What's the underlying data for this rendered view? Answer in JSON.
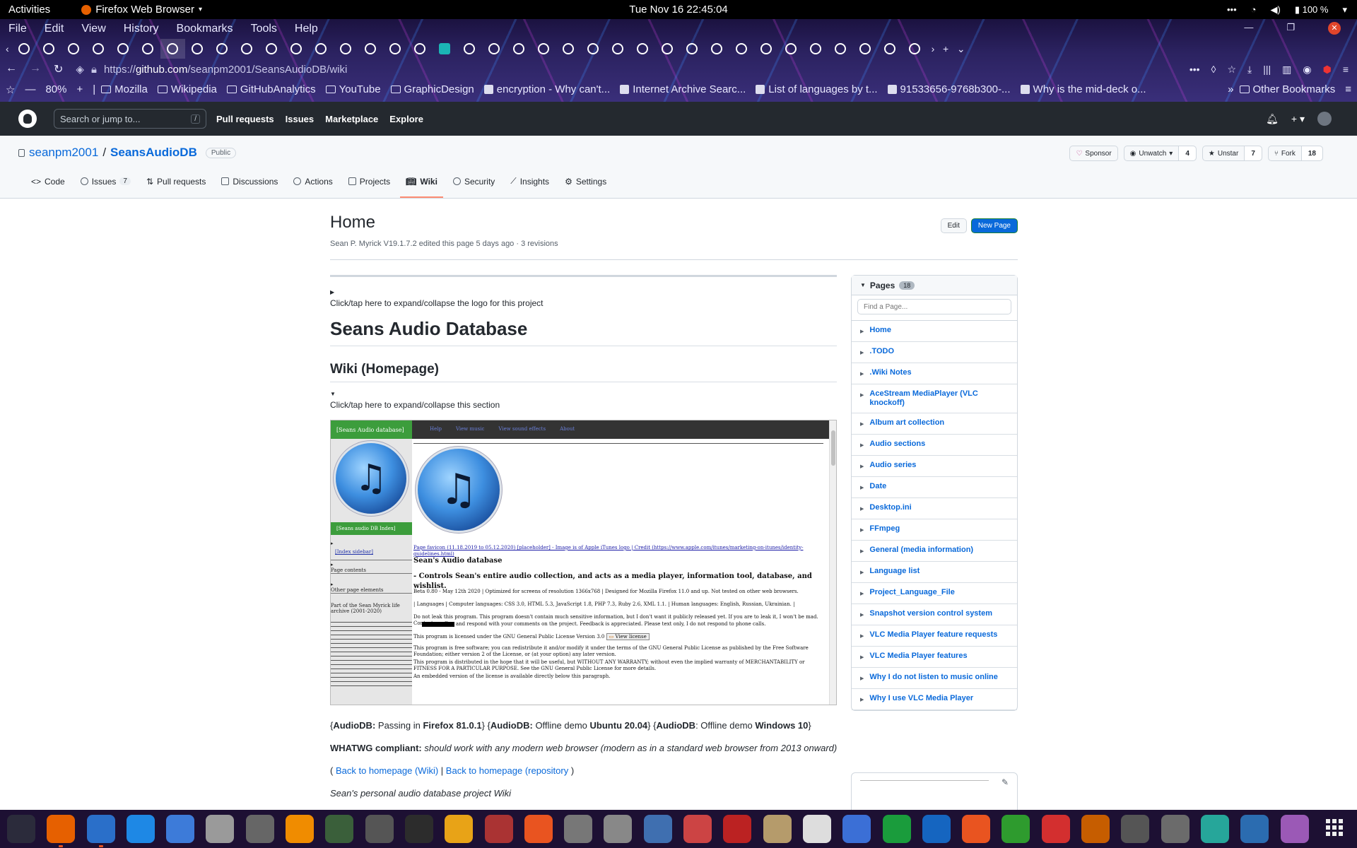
{
  "gnome": {
    "activities": "Activities",
    "app_name": "Firefox Web Browser",
    "clock": "Tue Nov 16  22:45:04",
    "battery": "100 %"
  },
  "firefox": {
    "menu": [
      "File",
      "Edit",
      "View",
      "History",
      "Bookmarks",
      "Tools",
      "Help"
    ],
    "tab_count": 37,
    "url_scheme": "https://",
    "url_host": "github.com",
    "url_path": "/seanpm2001/SeansAudioDB/wiki",
    "zoom": "80%",
    "bookmarks": [
      {
        "label": "Mozilla",
        "icon": "folder-icon"
      },
      {
        "label": "Wikipedia",
        "icon": "folder-icon"
      },
      {
        "label": "GitHubAnalytics",
        "icon": "folder-icon"
      },
      {
        "label": "YouTube",
        "icon": "folder-icon"
      },
      {
        "label": "GraphicDesign",
        "icon": "folder-icon"
      },
      {
        "label": "encryption - Why can't...",
        "icon": "stackexchange-icon"
      },
      {
        "label": "Internet Archive Searc...",
        "icon": "archive-icon"
      },
      {
        "label": "List of languages by t...",
        "icon": "wikipedia-icon"
      },
      {
        "label": "91533656-9768b300-...",
        "icon": "globe-icon"
      },
      {
        "label": "Why is the mid-deck o...",
        "icon": "stackexchange-icon"
      }
    ],
    "other_bookmarks": "Other Bookmarks"
  },
  "github": {
    "search_placeholder": "Search or jump to...",
    "search_shortcut": "/",
    "nav": [
      "Pull requests",
      "Issues",
      "Marketplace",
      "Explore"
    ]
  },
  "repo": {
    "owner": "seanpm2001",
    "separator": "/",
    "name": "SeansAudioDB",
    "visibility": "Public",
    "sponsor": "Sponsor",
    "watch": "Unwatch",
    "watch_count": "4",
    "star": "Unstar",
    "star_count": "7",
    "fork": "Fork",
    "fork_count": "18",
    "tabs": [
      {
        "label": "Code"
      },
      {
        "label": "Issues",
        "count": "7"
      },
      {
        "label": "Pull requests"
      },
      {
        "label": "Discussions"
      },
      {
        "label": "Actions"
      },
      {
        "label": "Projects"
      },
      {
        "label": "Wiki"
      },
      {
        "label": "Security"
      },
      {
        "label": "Insights"
      },
      {
        "label": "Settings"
      }
    ]
  },
  "wiki": {
    "title": "Home",
    "meta": "Sean P. Myrick V19.1.7.2 edited this page 5 days ago · 3 revisions",
    "edit": "Edit",
    "new_page": "New Page",
    "logo_caption": "Click/tap here to expand/collapse the logo for this project",
    "h1": "Seans Audio Database",
    "h2": "Wiki (Homepage)",
    "section_caption": "Click/tap here to expand/collapse this section",
    "embed": {
      "side_title": "[Seans Audio database]",
      "topbar_links": [
        "Help",
        "View music",
        "View sound effects",
        "About"
      ],
      "side_index": "[Seans audio DB Index]",
      "index_sidebar": "[Index sidebar]",
      "page_contents": "Page contents",
      "other_elements": "Other page elements",
      "archive_note": "Part of the Sean Myrick life archive (2001-2020)",
      "favicon_line": "Page favicon (11.18.2019 to 05.12.2020) [placeholder] - Image is of Apple iTunes logo | Credit (https://www.apple.com/itunes/marketing-on-itunes/identity-guidelines.html)",
      "heading": "Sean's Audio database",
      "subheading": "- Controls Sean's entire audio collection, and acts as a media player, information tool, database, and wishlist.",
      "beta": "Beta 0.80 - May 12th 2020 | Optimized for screens of resolution 1366x768 | Designed for Mozilla Firefox 11.0 and up. Not tested on other web browsers.",
      "languages": "| Languages | Computer languages: CSS 3.0, HTML 5.3, JavaScript 1.8, PHP 7.3, Ruby 2.6, XML 1.1. | Human languages: English, Russian, Ukrainian. |",
      "leak": "Do not leak this program. This program doesn't contain much sensitive information, but I don't want it publicly released yet. If you are to leak it, I won't be mad. Contact me @",
      "leak2": "and respond with your comments on the project. Feedback is appreciated. Please text only, I do not respond to phone calls.",
      "license": "This program is licensed under the GNU General Public License Version 3.0",
      "view_license": "View license",
      "free": "This program is free software; you can redistribute it and/or modify it under the terms of the GNU General Public License as published by the Free Software Foundation; either version 2 of the License, or (at your option) any later version.",
      "warranty": "This program is distributed in the hope that it will be useful, but WITHOUT ANY WARRANTY; without even the implied warranty of MERCHANTABILITY or FITNESS FOR A PARTICULAR PURPOSE. See the GNU General Public License for more details.",
      "embedded": "An embedded version of the license is available directly below this paragraph."
    },
    "status_line": {
      "a1": "AudioDB:",
      "t1": " Passing in ",
      "b1": "Firefox 81.0.1",
      "a2": "AudioDB:",
      "t2": " Offline demo ",
      "b2": "Ubuntu 20.04",
      "a3": "AudioDB",
      "t3": ": Offline demo ",
      "b3": "Windows 10"
    },
    "whatwg_label": "WHATWG compliant:",
    "whatwg_text": "should work with any modern web browser (modern as in a standard web browser from 2013 onward)",
    "back_wiki": "Back to homepage (Wiki)",
    "back_repo": "Back to homepage (repository",
    "cut_line": "Sean's personal audio database project Wiki"
  },
  "pages": {
    "title": "Pages",
    "count": "18",
    "find_placeholder": "Find a Page...",
    "items": [
      "Home",
      ".TODO",
      ".Wiki Notes",
      "AceStream MediaPlayer (VLC knockoff)",
      "Album art collection",
      "Audio sections",
      "Audio series",
      "Date",
      "Desktop.ini",
      "FFmpeg",
      "General (media information)",
      "Language list",
      "Project_Language_File",
      "Snapshot version control system",
      "VLC Media Player feature requests",
      "VLC Media Player features",
      "Why I do not listen to music online",
      "Why I use VLC Media Player"
    ]
  },
  "dock": {
    "apps": [
      {
        "name": "system-monitor-icon",
        "color": "#2b2b3b"
      },
      {
        "name": "firefox-icon",
        "color": "#e66000",
        "running": true
      },
      {
        "name": "libreoffice-writer-icon",
        "color": "#2a6fc9",
        "running": true
      },
      {
        "name": "help-icon",
        "color": "#1e88e5"
      },
      {
        "name": "text-editor-icon",
        "color": "#3d7bd9"
      },
      {
        "name": "files-icon",
        "color": "#9a9a9a"
      },
      {
        "name": "settings-icon",
        "color": "#666666"
      },
      {
        "name": "vlc-icon",
        "color": "#f08c00"
      },
      {
        "name": "terminal-add-icon",
        "color": "#3a5f3a"
      },
      {
        "name": "inkscape-icon",
        "color": "#555555"
      },
      {
        "name": "terminal-icon",
        "color": "#2c2c2c"
      },
      {
        "name": "calculator-icon",
        "color": "#e8a317"
      },
      {
        "name": "system-monitor-chart-icon",
        "color": "#aa3333"
      },
      {
        "name": "software-center-icon",
        "color": "#e95420"
      },
      {
        "name": "image-viewer-icon",
        "color": "#777777"
      },
      {
        "name": "disk-usage-icon",
        "color": "#888888"
      },
      {
        "name": "document-viewer-icon",
        "color": "#3f6fb0"
      },
      {
        "name": "screenshot-icon",
        "color": "#cc4444"
      },
      {
        "name": "pdf-editor-icon",
        "color": "#bb2222"
      },
      {
        "name": "archive-manager-icon",
        "color": "#b59b6b"
      },
      {
        "name": "character-map-icon",
        "color": "#dddddd"
      },
      {
        "name": "todo-icon",
        "color": "#3b6fd6"
      },
      {
        "name": "vim-icon",
        "color": "#1a9c3c"
      },
      {
        "name": "virtualbox-icon",
        "color": "#1565c0"
      },
      {
        "name": "update-icon",
        "color": "#e95420"
      },
      {
        "name": "spreadsheet-icon",
        "color": "#2e9b2e"
      },
      {
        "name": "alert-icon",
        "color": "#d32f2f"
      },
      {
        "name": "game-icon",
        "color": "#c65d00"
      },
      {
        "name": "cheese-icon",
        "color": "#555555"
      },
      {
        "name": "gimp-icon",
        "color": "#6b6b6b"
      },
      {
        "name": "calendar-icon",
        "color": "#26a69a"
      },
      {
        "name": "thunderbird-icon",
        "color": "#2b6cb0"
      },
      {
        "name": "music-icon",
        "color": "#9b59b6"
      }
    ],
    "show_apps": "show-applications-icon"
  }
}
